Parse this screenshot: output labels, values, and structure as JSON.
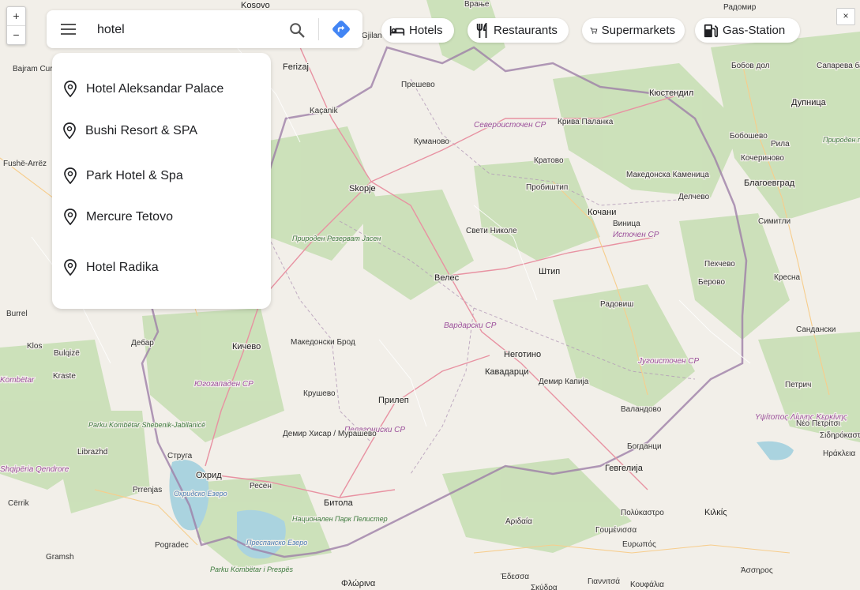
{
  "search": {
    "value": "hotel",
    "placeholder": ""
  },
  "icons": {
    "menu": "menu-icon",
    "search": "search-icon",
    "directions": "directions-icon",
    "pin": "map-pin-icon",
    "hotel": "bed-icon",
    "restaurant": "fork-knife-icon",
    "supermarket": "cart-icon",
    "gas": "gas-pump-icon"
  },
  "categories": [
    {
      "label": "Hotels"
    },
    {
      "label": "Restaurants"
    },
    {
      "label": "Supermarkets"
    },
    {
      "label": "Gas-Station"
    }
  ],
  "suggestions": [
    {
      "label": "Hotel Aleksandar Palace"
    },
    {
      "label": "Bushi Resort & SPA"
    },
    {
      "label": "Park Hotel & Spa"
    },
    {
      "label": "Mercure Tetovo"
    },
    {
      "label": "Hotel Radika"
    }
  ],
  "zoom": {
    "in": "+",
    "out": "−"
  },
  "close": "×",
  "colors": {
    "accent": "#4285f4",
    "water": "#aad3df",
    "forest": "#b7d9a3",
    "border": "#9e7fa8"
  },
  "map_labels": [
    {
      "text": "Kosovo"
    },
    {
      "text": "Врање"
    },
    {
      "text": "Радомир"
    },
    {
      "text": "Ferizaj"
    },
    {
      "text": "Gjilan"
    },
    {
      "text": "Прешево"
    },
    {
      "text": "Бобов дол"
    },
    {
      "text": "Сапарева баня"
    },
    {
      "text": "Bajram Curri"
    },
    {
      "text": "Кюстендил"
    },
    {
      "text": "Kaçanik"
    },
    {
      "text": "Североисточен СР"
    },
    {
      "text": "Крива Паланка"
    },
    {
      "text": "Дупница"
    },
    {
      "text": "Куманово"
    },
    {
      "text": "Бобошево"
    },
    {
      "text": "Рила"
    },
    {
      "text": "Природен парк Рилски манастир"
    },
    {
      "text": "Кратово"
    },
    {
      "text": "Кочериново"
    },
    {
      "text": "Fushë-Arrëz"
    },
    {
      "text": "Македонска Каменица"
    },
    {
      "text": "Пробиштип"
    },
    {
      "text": "Skopje"
    },
    {
      "text": "Благоевград"
    },
    {
      "text": "Делчево"
    },
    {
      "text": "Кочани"
    },
    {
      "text": "Виница"
    },
    {
      "text": "Источен СР"
    },
    {
      "text": "Симитли"
    },
    {
      "text": "Свети Николе"
    },
    {
      "text": "Природен Резерват Јасен"
    },
    {
      "text": "Пехчево"
    },
    {
      "text": "Велес"
    },
    {
      "text": "Штип"
    },
    {
      "text": "Берово"
    },
    {
      "text": "Кресна"
    },
    {
      "text": "Радовиш"
    },
    {
      "text": "Burrel"
    },
    {
      "text": "Вардарски СР"
    },
    {
      "text": "Сандански"
    },
    {
      "text": "Klos"
    },
    {
      "text": "Дебар"
    },
    {
      "text": "Кичево"
    },
    {
      "text": "Македонски Брод"
    },
    {
      "text": "Неготино"
    },
    {
      "text": "Bulqizë"
    },
    {
      "text": "Кавадарци"
    },
    {
      "text": "Југоисточен СР"
    },
    {
      "text": "Kraste"
    },
    {
      "text": "Югозападен СР"
    },
    {
      "text": "Демир Капија"
    },
    {
      "text": "Петрич"
    },
    {
      "text": "Kombëtar"
    },
    {
      "text": "Крушево"
    },
    {
      "text": "Прилеп"
    },
    {
      "text": "Валандово"
    },
    {
      "text": "Υψίτοπος Λίμνης Κερκίνης"
    },
    {
      "text": "Νέο Πετρίτσι"
    },
    {
      "text": "Parku Kombëtar Shebenik-Jabllanicë"
    },
    {
      "text": "Пелагониски СР"
    },
    {
      "text": "Демир Хисар / Мурашево"
    },
    {
      "text": "Богданци"
    },
    {
      "text": "Σιδηρόκαστρο"
    },
    {
      "text": "Librazhd"
    },
    {
      "text": "Струга"
    },
    {
      "text": "Гевгелија"
    },
    {
      "text": "Ηράκλεια"
    },
    {
      "text": "Shqipëria Qendrore"
    },
    {
      "text": "Охрид"
    },
    {
      "text": "Ресен"
    },
    {
      "text": "Prrenjas"
    },
    {
      "text": "Охридско Езеро"
    },
    {
      "text": "Битола"
    },
    {
      "text": "Cërrik"
    },
    {
      "text": "Национален Парк Пелистер"
    },
    {
      "text": "Αριδαία"
    },
    {
      "text": "Πολύκαστρο"
    },
    {
      "text": "Κιλκίς"
    },
    {
      "text": "Pogradec"
    },
    {
      "text": "Преспанско Езеро"
    },
    {
      "text": "Γουμένισσα"
    },
    {
      "text": "Ευρωπός"
    },
    {
      "text": "Gramsh"
    },
    {
      "text": "Parku Kombëtar i Prespës"
    },
    {
      "text": "Έδεσσα"
    },
    {
      "text": "Φλώρινα"
    },
    {
      "text": "Γιαννιτσά"
    },
    {
      "text": "Άσσηρος"
    },
    {
      "text": "Κουφάλια"
    },
    {
      "text": "Σκύδρα"
    }
  ]
}
